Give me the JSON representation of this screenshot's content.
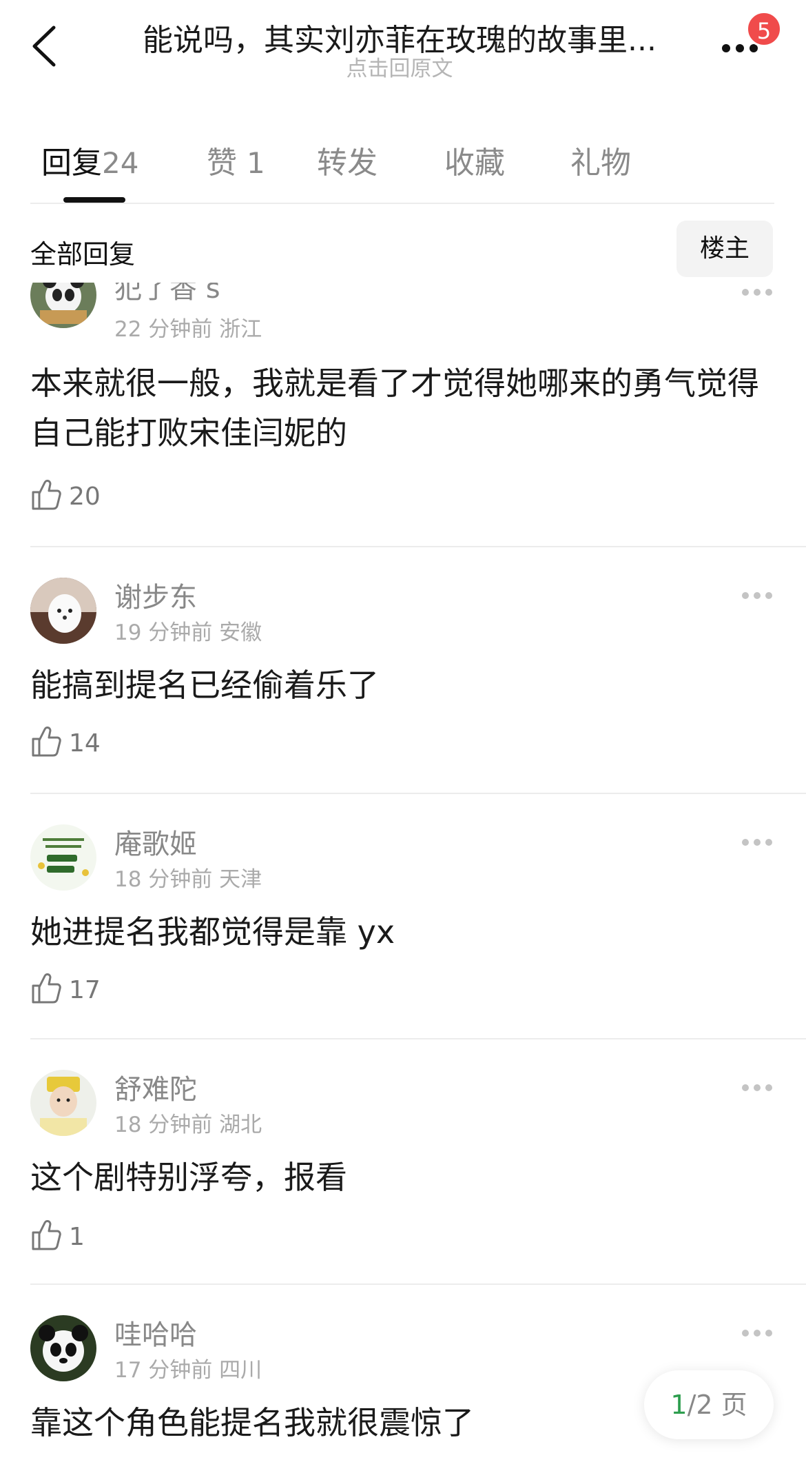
{
  "header": {
    "title": "能说吗，其实刘亦菲在玫瑰的故事里...",
    "subtitle": "点击回原文",
    "badge_count": "5"
  },
  "tabs": [
    {
      "label": "回复",
      "count": "24",
      "active": true
    },
    {
      "label": "赞",
      "count": "1",
      "active": false
    },
    {
      "label": "转发",
      "count": "",
      "active": false
    },
    {
      "label": "收藏",
      "count": "",
      "active": false
    },
    {
      "label": "礼物",
      "count": "",
      "active": false
    }
  ],
  "section": {
    "title": "全部回复",
    "op_button": "楼主"
  },
  "comments": [
    {
      "name": "犯了香 s",
      "time": "22 分钟前",
      "location": "浙江",
      "text": "本来就很一般，我就是看了才觉得她哪来的勇气觉得自己能打败宋佳闫妮的",
      "likes": "20",
      "avatar": "panda-avatar"
    },
    {
      "name": "谢步东",
      "time": "19 分钟前",
      "location": "安徽",
      "text": "能搞到提名已经偷着乐了",
      "likes": "14",
      "avatar": "white-dog-avatar"
    },
    {
      "name": "庵歌姬",
      "time": "18 分钟前",
      "location": "天津",
      "text": "她进提名我都觉得是靠 yx",
      "likes": "17",
      "avatar": "lettering-avatar"
    },
    {
      "name": "舒难陀",
      "time": "18 分钟前",
      "location": "湖北",
      "text": "这个剧特别浮夸，报看",
      "likes": "1",
      "avatar": "costume-avatar"
    },
    {
      "name": "哇哈哈",
      "time": "17 分钟前",
      "location": "四川",
      "text": "靠这个角色能提名我就很震惊了",
      "likes": "",
      "avatar": "panda-avatar"
    }
  ],
  "pager": {
    "current": "1",
    "total": "/2 页"
  },
  "colors": {
    "accent_green": "#2e9e4f",
    "badge_red": "#f04b4b"
  }
}
